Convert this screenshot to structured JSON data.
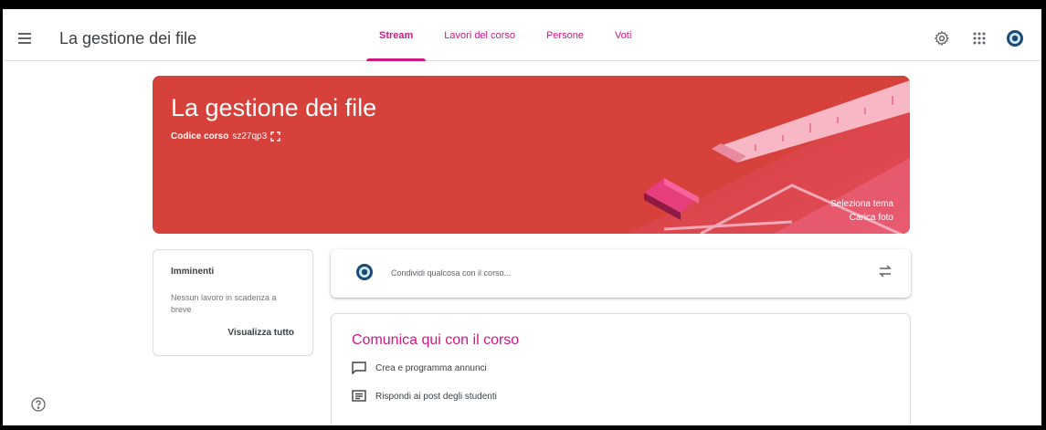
{
  "header": {
    "title": "La gestione dei file",
    "tabs": {
      "stream": "Stream",
      "lavori": "Lavori del corso",
      "persone": "Persone",
      "voti": "Voti"
    }
  },
  "banner": {
    "title": "La gestione dei file",
    "code_label": "Codice corso",
    "code_value": "sz27qp3",
    "select_theme": "Seleziona tema",
    "upload_photo": "Carica foto"
  },
  "upcoming": {
    "heading": "Imminenti",
    "message": "Nessun lavoro in scadenza a breve",
    "view_all": "Visualizza tutto"
  },
  "share": {
    "placeholder": "Condividi qualcosa con il corso..."
  },
  "comunica": {
    "heading": "Comunica qui con il corso",
    "item_create": "Crea e programma annunci",
    "item_reply": "Rispondi ai post degli studenti"
  },
  "colors": {
    "accent": "#d01884",
    "banner": "#d6413c"
  }
}
